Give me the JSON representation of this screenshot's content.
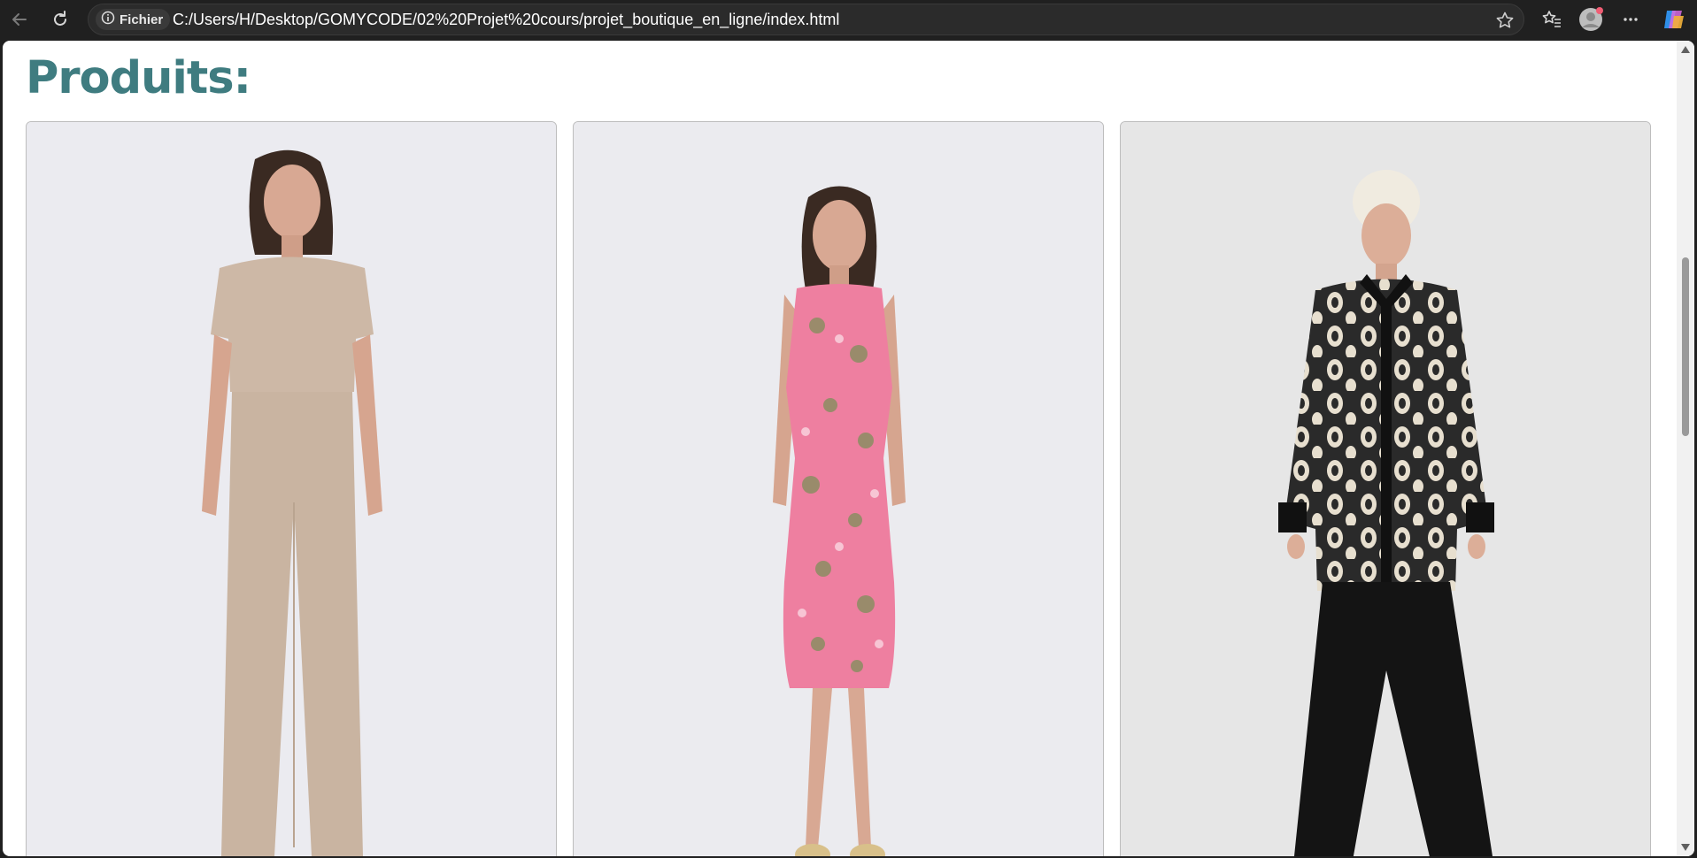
{
  "browser": {
    "site_info_label": "Fichier",
    "url": "C:/Users/H/Desktop/GOMYCODE/02%20Projet%20cours/projet_boutique_en_ligne/index.html",
    "icons": [
      "back-arrow-icon",
      "reload-icon",
      "info-icon",
      "star-icon",
      "favorites-icon",
      "profile-avatar-icon",
      "more-menu-icon",
      "copilot-icon"
    ]
  },
  "page": {
    "title": "Produits:"
  },
  "products": [
    {
      "name": "product-beige-set",
      "colors": {
        "top": "#cdb8a6",
        "pants": "#c9b4a1",
        "bg": "#ebebf0"
      }
    },
    {
      "name": "product-pink-floral-dress",
      "colors": {
        "dress": "#ee7fa0",
        "bg": "#ebebef"
      }
    },
    {
      "name": "product-patterned-shirt",
      "colors": {
        "shirt": "#2a2a2a",
        "pattern": "#e7dfcf",
        "pants": "#141414",
        "bg": "#e6e6e6"
      }
    }
  ],
  "colors": {
    "heading": "#3f7c80",
    "browser_bg": "#202020"
  }
}
